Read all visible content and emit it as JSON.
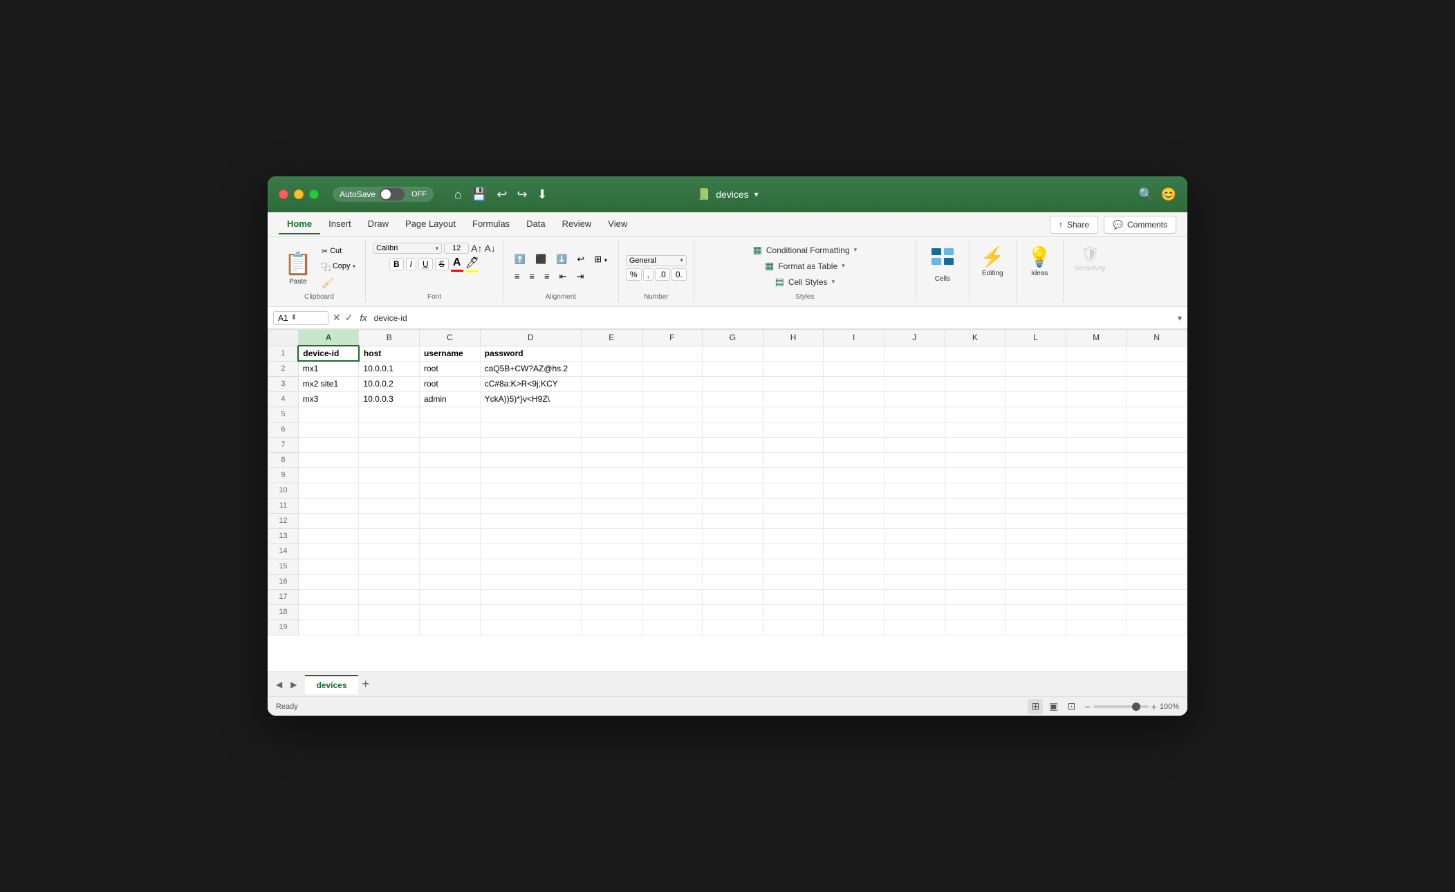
{
  "window": {
    "title": "devices",
    "autosave_label": "AutoSave",
    "toggle_state": "OFF"
  },
  "ribbon": {
    "tabs": [
      {
        "id": "home",
        "label": "Home",
        "active": true
      },
      {
        "id": "insert",
        "label": "Insert",
        "active": false
      },
      {
        "id": "draw",
        "label": "Draw",
        "active": false
      },
      {
        "id": "page_layout",
        "label": "Page Layout",
        "active": false
      },
      {
        "id": "formulas",
        "label": "Formulas",
        "active": false
      },
      {
        "id": "data",
        "label": "Data",
        "active": false
      },
      {
        "id": "review",
        "label": "Review",
        "active": false
      },
      {
        "id": "view",
        "label": "View",
        "active": false
      }
    ],
    "share_label": "Share",
    "comments_label": "Comments",
    "groups": {
      "clipboard": {
        "label": "Paste",
        "group_label": ""
      },
      "font": {
        "label": "Font",
        "font_name": "Calibri",
        "font_size": "12",
        "bold": "B",
        "italic": "I",
        "underline": "U",
        "strikethrough": "S"
      },
      "alignment": {
        "label": "Alignment"
      },
      "number": {
        "label": "Number",
        "format": "General"
      },
      "styles": {
        "conditional_formatting": "Conditional Formatting",
        "format_as_table": "Format as Table",
        "cell_styles": "Cell Styles",
        "label": "Styles"
      },
      "cells": {
        "label": "Cells"
      },
      "editing": {
        "label": "Editing"
      },
      "ideas": {
        "label": "Ideas"
      },
      "sensitivity": {
        "label": "Sensitivity"
      }
    }
  },
  "formula_bar": {
    "cell_ref": "A1",
    "formula_value": "device-id"
  },
  "spreadsheet": {
    "columns": [
      "A",
      "B",
      "C",
      "D",
      "E",
      "F",
      "G",
      "H",
      "I",
      "J",
      "K",
      "L",
      "M",
      "N"
    ],
    "rows": [
      {
        "row_num": 1,
        "cells": [
          "device-id",
          "host",
          "username",
          "password",
          "",
          "",
          "",
          "",
          "",
          "",
          "",
          "",
          "",
          ""
        ],
        "is_header": true
      },
      {
        "row_num": 2,
        "cells": [
          "mx1",
          "10.0.0.1",
          "root",
          "caQ5B+CW?AZ@hs.2",
          "",
          "",
          "",
          "",
          "",
          "",
          "",
          "",
          "",
          ""
        ]
      },
      {
        "row_num": 3,
        "cells": [
          "mx2 site1",
          "10.0.0.2",
          "root",
          "cC#8a:K>R<9j;KCY",
          "",
          "",
          "",
          "",
          "",
          "",
          "",
          "",
          "",
          ""
        ]
      },
      {
        "row_num": 4,
        "cells": [
          "mx3",
          "10.0.0.3",
          "admin",
          "YckA))5)*}v<H9Z\\",
          "",
          "",
          "",
          "",
          "",
          "",
          "",
          "",
          "",
          ""
        ]
      },
      {
        "row_num": 5,
        "cells": [
          "",
          "",
          "",
          "",
          "",
          "",
          "",
          "",
          "",
          "",
          "",
          "",
          "",
          ""
        ]
      },
      {
        "row_num": 6,
        "cells": [
          "",
          "",
          "",
          "",
          "",
          "",
          "",
          "",
          "",
          "",
          "",
          "",
          "",
          ""
        ]
      },
      {
        "row_num": 7,
        "cells": [
          "",
          "",
          "",
          "",
          "",
          "",
          "",
          "",
          "",
          "",
          "",
          "",
          "",
          ""
        ]
      },
      {
        "row_num": 8,
        "cells": [
          "",
          "",
          "",
          "",
          "",
          "",
          "",
          "",
          "",
          "",
          "",
          "",
          "",
          ""
        ]
      },
      {
        "row_num": 9,
        "cells": [
          "",
          "",
          "",
          "",
          "",
          "",
          "",
          "",
          "",
          "",
          "",
          "",
          "",
          ""
        ]
      },
      {
        "row_num": 10,
        "cells": [
          "",
          "",
          "",
          "",
          "",
          "",
          "",
          "",
          "",
          "",
          "",
          "",
          "",
          ""
        ]
      },
      {
        "row_num": 11,
        "cells": [
          "",
          "",
          "",
          "",
          "",
          "",
          "",
          "",
          "",
          "",
          "",
          "",
          "",
          ""
        ]
      },
      {
        "row_num": 12,
        "cells": [
          "",
          "",
          "",
          "",
          "",
          "",
          "",
          "",
          "",
          "",
          "",
          "",
          "",
          ""
        ]
      },
      {
        "row_num": 13,
        "cells": [
          "",
          "",
          "",
          "",
          "",
          "",
          "",
          "",
          "",
          "",
          "",
          "",
          "",
          ""
        ]
      },
      {
        "row_num": 14,
        "cells": [
          "",
          "",
          "",
          "",
          "",
          "",
          "",
          "",
          "",
          "",
          "",
          "",
          "",
          ""
        ]
      },
      {
        "row_num": 15,
        "cells": [
          "",
          "",
          "",
          "",
          "",
          "",
          "",
          "",
          "",
          "",
          "",
          "",
          "",
          ""
        ]
      },
      {
        "row_num": 16,
        "cells": [
          "",
          "",
          "",
          "",
          "",
          "",
          "",
          "",
          "",
          "",
          "",
          "",
          "",
          ""
        ]
      },
      {
        "row_num": 17,
        "cells": [
          "",
          "",
          "",
          "",
          "",
          "",
          "",
          "",
          "",
          "",
          "",
          "",
          "",
          ""
        ]
      },
      {
        "row_num": 18,
        "cells": [
          "",
          "",
          "",
          "",
          "",
          "",
          "",
          "",
          "",
          "",
          "",
          "",
          "",
          ""
        ]
      },
      {
        "row_num": 19,
        "cells": [
          "",
          "",
          "",
          "",
          "",
          "",
          "",
          "",
          "",
          "",
          "",
          "",
          "",
          ""
        ]
      }
    ]
  },
  "sheet_tabs": [
    {
      "id": "devices",
      "label": "devices",
      "active": true
    }
  ],
  "status_bar": {
    "ready_label": "Ready",
    "zoom_level": "100%"
  }
}
